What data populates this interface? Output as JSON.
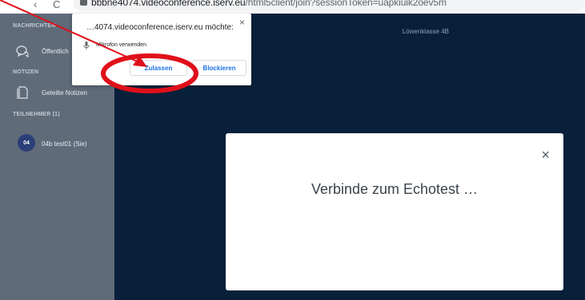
{
  "browser": {
    "back_glyph": "‹",
    "reload_glyph": "C",
    "url_host": "bbbne4074.videoconference.iserv.eu",
    "url_path": "/html5client/join?sessionToken=uapkiuik2oev5m"
  },
  "sidebar": {
    "sections": {
      "messages": "NACHRICHTEN",
      "notes": "NOTIZEN",
      "participants": "TEILNEHMER (1)"
    },
    "items": {
      "public_chat": "Öffentlich",
      "shared_notes": "Geteilte Notizen"
    },
    "user": {
      "initials": "04",
      "name": "04b test01 (Sie)"
    },
    "icons": {
      "chat": "chat-bubbles-icon",
      "notes": "notes-icon"
    }
  },
  "main": {
    "meeting_title": "Löwenklasse 4B"
  },
  "modal": {
    "message": "Verbinde zum Echotest …",
    "close_glyph": "×"
  },
  "permission_popup": {
    "title": "…4074.videoconference.iserv.eu möchte:",
    "permission": "Mikrofon verwenden",
    "allow_label": "Zulassen",
    "block_label": "Blockieren",
    "close_glyph": "×",
    "icon": "microphone-icon"
  },
  "colors": {
    "sidebar_bg": "#5f6b79",
    "main_bg": "#08203a",
    "annotation_red": "#e0101a"
  }
}
